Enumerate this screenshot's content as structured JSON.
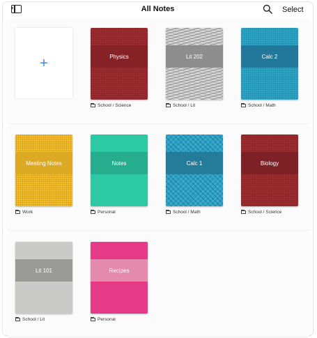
{
  "header": {
    "title": "All Notes",
    "select_label": "Select"
  },
  "new_note": {
    "label": "+"
  },
  "notebooks": [
    {
      "title": "Physics",
      "location": "School / Science",
      "color": "#9b2b2f",
      "band": "#862126",
      "pattern": "dots"
    },
    {
      "title": "Lit 202",
      "location": "School / Lit",
      "color": "#c6c6c6",
      "band": "#8e8e8e",
      "pattern": "waves"
    },
    {
      "title": "Calc 2",
      "location": "School / Math",
      "color": "#2ba4c6",
      "band": "#22789a",
      "pattern": "dots"
    },
    {
      "title": "Meeting Notes",
      "location": "Work",
      "color": "#f2bb27",
      "band": "#ddaa23",
      "pattern": "dots"
    },
    {
      "title": "Notes",
      "location": "Personal",
      "color": "#2cc9a4",
      "band": "#26ad8e",
      "pattern": "plain"
    },
    {
      "title": "Calc 1",
      "location": "School / Math",
      "color": "#2aa1c4",
      "band": "#237c9a",
      "pattern": "zigzag"
    },
    {
      "title": "Biology",
      "location": "School / Science",
      "color": "#9b2b2f",
      "band": "#7e2126",
      "pattern": "dots"
    },
    {
      "title": "Lit 101",
      "location": "School / Lit",
      "color": "#cfcfcc",
      "band": "#9a9a97",
      "pattern": "grain"
    },
    {
      "title": "Recipes",
      "location": "Personal",
      "color": "#ea3b88",
      "band": "#e38aad",
      "pattern": "grain"
    }
  ]
}
